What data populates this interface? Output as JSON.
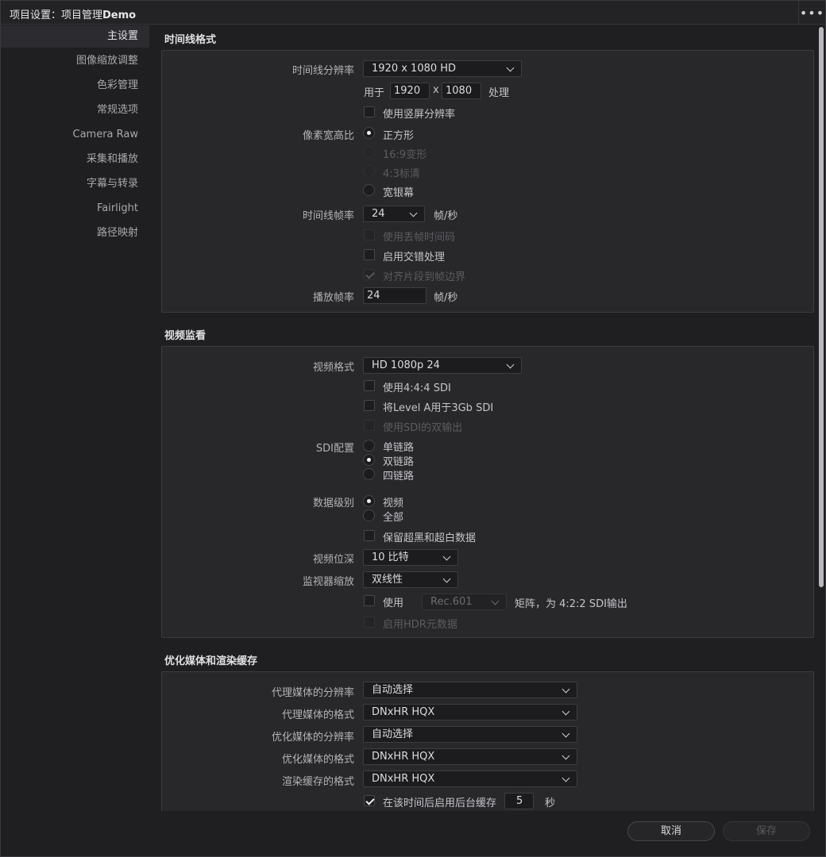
{
  "window": {
    "title_prefix": "项目设置：项目管理",
    "title_project": "Demo",
    "more_label": "•••"
  },
  "sidebar": {
    "items": [
      {
        "label": "主设置",
        "active": true
      },
      {
        "label": "图像缩放调整"
      },
      {
        "label": "色彩管理"
      },
      {
        "label": "常规选项"
      },
      {
        "label": "Camera Raw"
      },
      {
        "label": "采集和播放"
      },
      {
        "label": "字幕与转录"
      },
      {
        "label": "Fairlight"
      },
      {
        "label": "路径映射"
      }
    ]
  },
  "timeline": {
    "section_title": "时间线格式",
    "resolution_label": "时间线分辨率",
    "resolution_value": "1920 x 1080 HD",
    "for_label": "用于",
    "width": "1920",
    "x_sep": "x",
    "height": "1080",
    "process_label": "处理",
    "vertical_label": "使用竖屏分辨率",
    "pixel_aspect_label": "像素宽高比",
    "pixel_aspect_options": [
      "正方形",
      "16:9变形",
      "4:3标清",
      "宽银幕"
    ],
    "frame_rate_label": "时间线帧率",
    "frame_rate_value": "24",
    "fps_unit": "帧/秒",
    "drop_frame_label": "使用丢帧时间码",
    "interlace_label": "启用交错处理",
    "snap_label": "对齐片段到帧边界",
    "playback_label": "播放帧率",
    "playback_value": "24",
    "playback_unit": "帧/秒"
  },
  "video_monitor": {
    "section_title": "视频监看",
    "format_label": "视频格式",
    "format_value": "HD 1080p 24",
    "use444_label": "使用4:4:4 SDI",
    "levelA_label": "将Level A用于3Gb SDI",
    "dual_out_label": "使用SDI的双输出",
    "sdi_label": "SDI配置",
    "sdi_options": [
      "单链路",
      "双链路",
      "四链路"
    ],
    "data_level_label": "数据级别",
    "data_level_options": [
      "视频",
      "全部"
    ],
    "retain_label": "保留超黑和超白数据",
    "bit_depth_label": "视频位深",
    "bit_depth_value": "10 比特",
    "scaling_label": "监视器缩放",
    "scaling_value": "双线性",
    "use_label": "使用",
    "matrix_value": "Rec.601",
    "matrix_suffix": "矩阵，为 4:2:2 SDI输出",
    "hdr_label": "启用HDR元数据"
  },
  "optimized": {
    "section_title": "优化媒体和渲染缓存",
    "rows": [
      {
        "label": "代理媒体的分辨率",
        "value": "自动选择"
      },
      {
        "label": "代理媒体的格式",
        "value": "DNxHR HQX"
      },
      {
        "label": "优化媒体的分辨率",
        "value": "自动选择"
      },
      {
        "label": "优化媒体的格式",
        "value": "DNxHR HQX"
      },
      {
        "label": "渲染缓存的格式",
        "value": "DNxHR HQX"
      }
    ],
    "bg_cache_label": "在该时间后启用后台缓存",
    "bg_cache_value": "5",
    "bg_cache_unit": "秒"
  },
  "footer": {
    "cancel_label": "取消",
    "save_label": "保存"
  }
}
